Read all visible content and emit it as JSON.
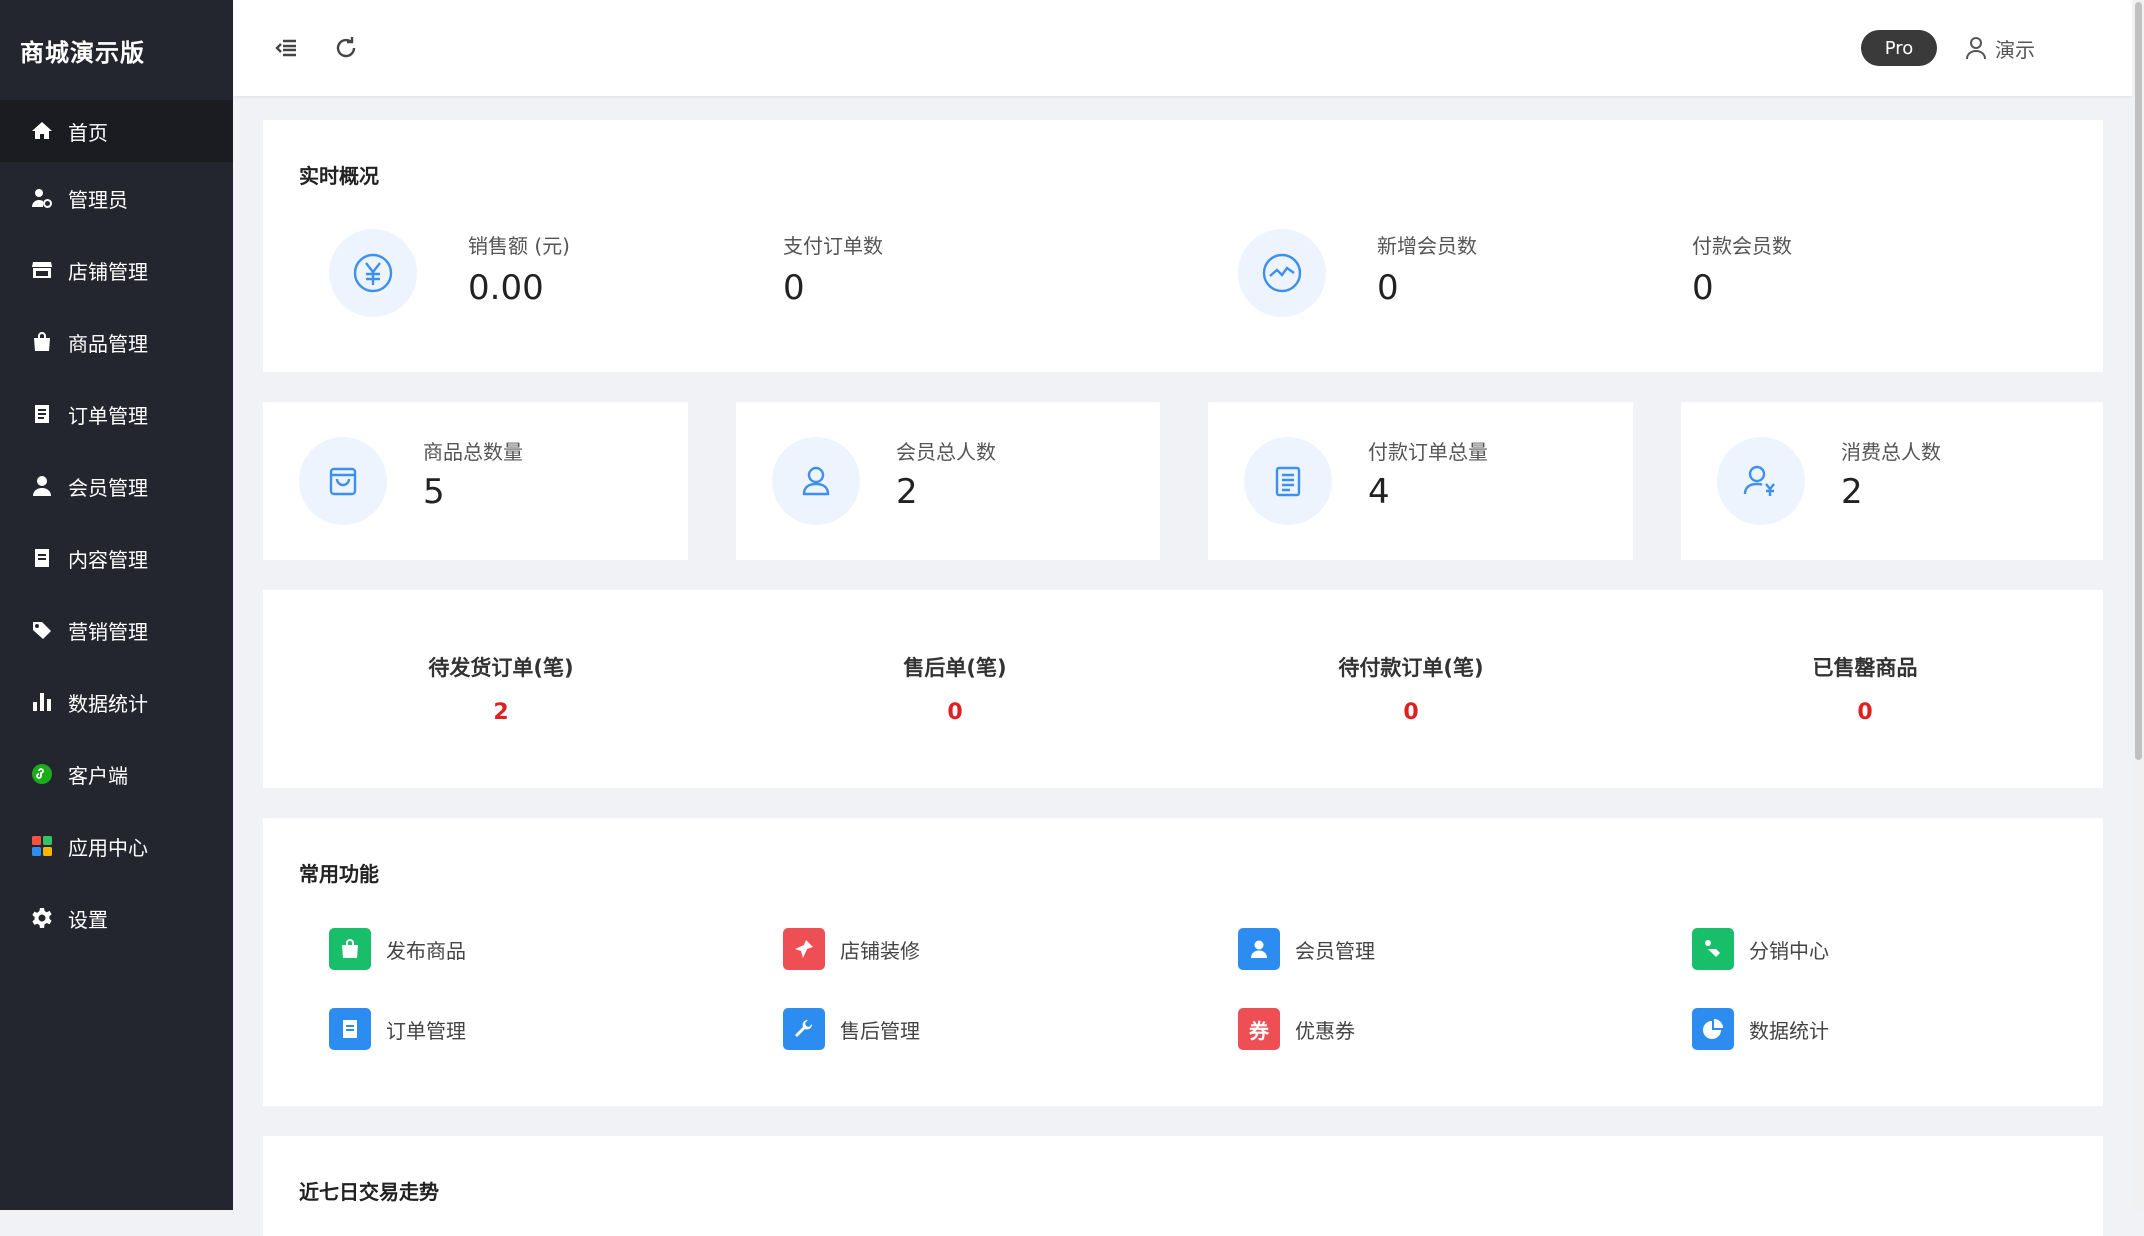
{
  "app": {
    "title": "商城演示版"
  },
  "sidebar": {
    "items": [
      {
        "label": "首页",
        "icon": "home-icon"
      },
      {
        "label": "管理员",
        "icon": "admin-icon"
      },
      {
        "label": "店铺管理",
        "icon": "shop-icon"
      },
      {
        "label": "商品管理",
        "icon": "basket-icon"
      },
      {
        "label": "订单管理",
        "icon": "clipboard-icon"
      },
      {
        "label": "会员管理",
        "icon": "user-icon"
      },
      {
        "label": "内容管理",
        "icon": "document-icon"
      },
      {
        "label": "营销管理",
        "icon": "tags-icon"
      },
      {
        "label": "数据统计",
        "icon": "bar-chart-icon"
      },
      {
        "label": "客户端",
        "icon": "mini-program-icon"
      },
      {
        "label": "应用中心",
        "icon": "apps-grid-icon"
      },
      {
        "label": "设置",
        "icon": "gear-icon"
      }
    ]
  },
  "header": {
    "badge": "Pro",
    "user": "演示"
  },
  "realtime": {
    "title": "实时概况",
    "stats": [
      {
        "label": "销售额 (元)",
        "value": "0.00",
        "icon": "yuan-icon"
      },
      {
        "label": "支付订单数",
        "value": "0"
      },
      {
        "label": "新增会员数",
        "value": "0",
        "icon": "trend-icon"
      },
      {
        "label": "付款会员数",
        "value": "0"
      }
    ]
  },
  "totals": [
    {
      "label": "商品总数量",
      "value": "5",
      "icon": "bag-icon"
    },
    {
      "label": "会员总人数",
      "value": "2",
      "icon": "person-icon"
    },
    {
      "label": "付款订单总量",
      "value": "4",
      "icon": "list-icon"
    },
    {
      "label": "消费总人数",
      "value": "2",
      "icon": "person-yuan-icon"
    }
  ],
  "pending": [
    {
      "label": "待发货订单(笔)",
      "value": "2"
    },
    {
      "label": "售后单(笔)",
      "value": "0"
    },
    {
      "label": "待付款订单(笔)",
      "value": "0"
    },
    {
      "label": "已售罄商品",
      "value": "0"
    }
  ],
  "functions": {
    "title": "常用功能",
    "items": [
      {
        "label": "发布商品",
        "color": "#19be6b",
        "icon": "shopping-bag-icon"
      },
      {
        "label": "店铺装修",
        "color": "#ed4f54",
        "icon": "brush-icon"
      },
      {
        "label": "会员管理",
        "color": "#2d8cf0",
        "icon": "member-icon"
      },
      {
        "label": "分销中心",
        "color": "#19be6b",
        "icon": "share-icon"
      },
      {
        "label": "订单管理",
        "color": "#2d8cf0",
        "icon": "order-icon"
      },
      {
        "label": "售后管理",
        "color": "#2d8cf0",
        "icon": "wrench-icon"
      },
      {
        "label": "优惠券",
        "color": "#ed4f54",
        "icon": "coupon-icon",
        "glyph": "券"
      },
      {
        "label": "数据统计",
        "color": "#2d8cf0",
        "icon": "pie-chart-icon"
      }
    ]
  },
  "trend": {
    "title": "近七日交易走势"
  }
}
